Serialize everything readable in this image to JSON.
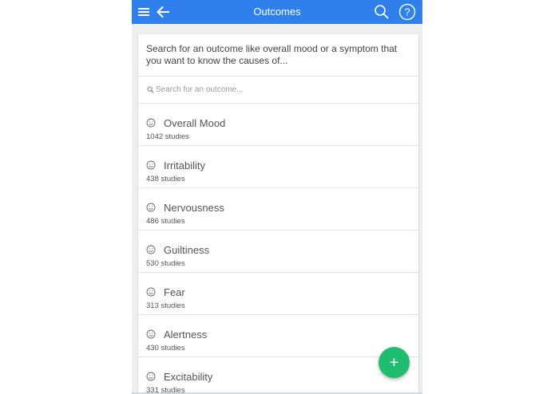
{
  "toolbar": {
    "title": "Outcomes",
    "icons": [
      "menu-icon",
      "back-arrow-icon",
      "search-icon",
      "help-icon"
    ]
  },
  "intro": {
    "text": "Search for an outcome like overall mood or a symptom that you want to know the causes of..."
  },
  "search": {
    "placeholder": "Search for an outcome...",
    "value": ""
  },
  "outcomes": [
    {
      "name": "Overall Mood",
      "studies": "1042 studies"
    },
    {
      "name": "Irritability",
      "studies": "438 studies"
    },
    {
      "name": "Nervousness",
      "studies": "486 studies"
    },
    {
      "name": "Guiltiness",
      "studies": "530 studies"
    },
    {
      "name": "Fear",
      "studies": "313 studies"
    },
    {
      "name": "Alertness",
      "studies": "430 studies"
    },
    {
      "name": "Excitability",
      "studies": "331 studies"
    }
  ],
  "fab": {
    "label": "+"
  },
  "colors": {
    "toolbar": "#2f80ed",
    "fab": "#1fbd6f",
    "background": "#eeeeee"
  }
}
